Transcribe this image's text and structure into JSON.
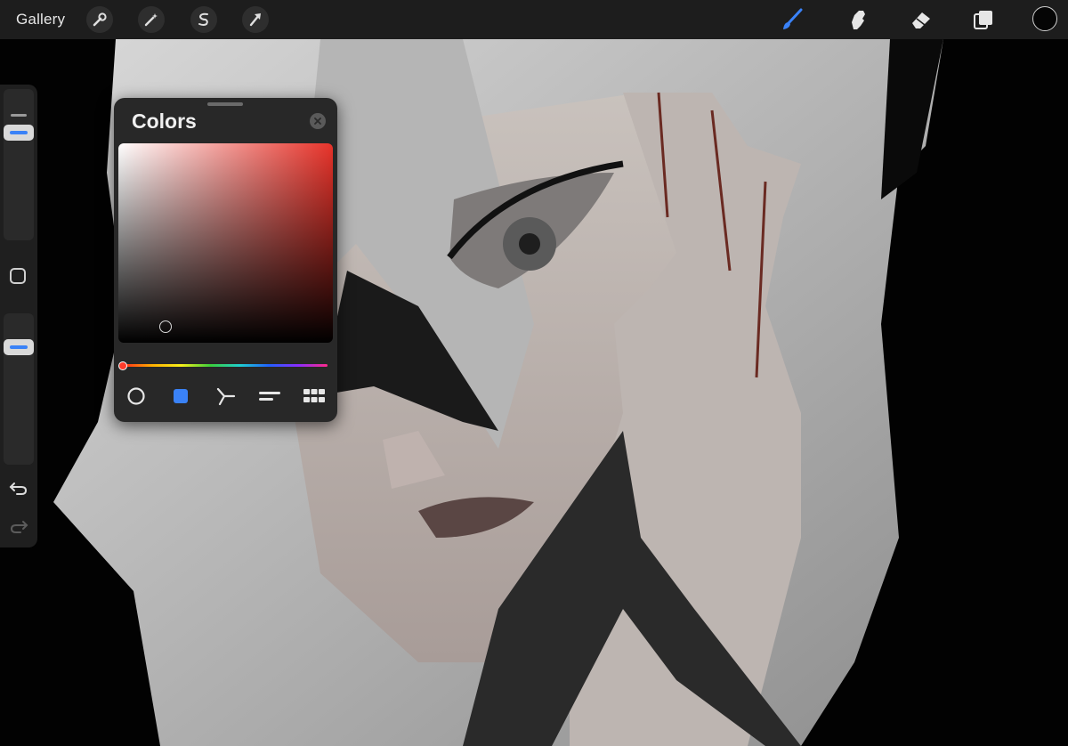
{
  "toolbar": {
    "gallery_label": "Gallery",
    "left_icons": [
      "wrench-icon",
      "magic-wand-icon",
      "selection-s-icon",
      "transform-arrow-icon"
    ],
    "right_icons": [
      "brush-icon",
      "smudge-icon",
      "eraser-icon",
      "layers-icon"
    ],
    "active_tool": "brush",
    "current_color": "#050505",
    "accent_color": "#3a82f7"
  },
  "sidebar": {
    "brush_size_level": 0.88,
    "opacity_level": 0.8,
    "icons": [
      "modify-square-icon",
      "undo-icon",
      "redo-icon"
    ]
  },
  "colors_panel": {
    "title": "Colors",
    "hue_color": "#e8332a",
    "active_mode": "classic",
    "modes": [
      "disc",
      "classic",
      "harmony",
      "value",
      "palettes"
    ]
  }
}
